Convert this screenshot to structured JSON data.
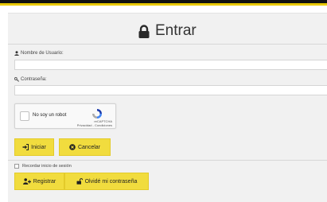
{
  "colors": {
    "accent": "#f1dc3e",
    "topbar": "#111111",
    "panel": "#f1f1f1"
  },
  "login": {
    "title": "Entrar",
    "title_icon": "lock-icon",
    "username_label": "Nombre de Usuario:",
    "username_value": "",
    "password_label": "Contraseña:",
    "password_value": ""
  },
  "captcha": {
    "label": "No soy un robot",
    "brand": "reCAPTCHA",
    "links": "Privacidad - Condiciones",
    "checked": false
  },
  "actions": {
    "login_label": "Iniciar",
    "cancel_label": "Cancelar",
    "remember_label": "Recordar inicio de sesión",
    "remember_checked": false,
    "register_label": "Registrar",
    "forgot_label": "Olvidé mi contraseña"
  }
}
